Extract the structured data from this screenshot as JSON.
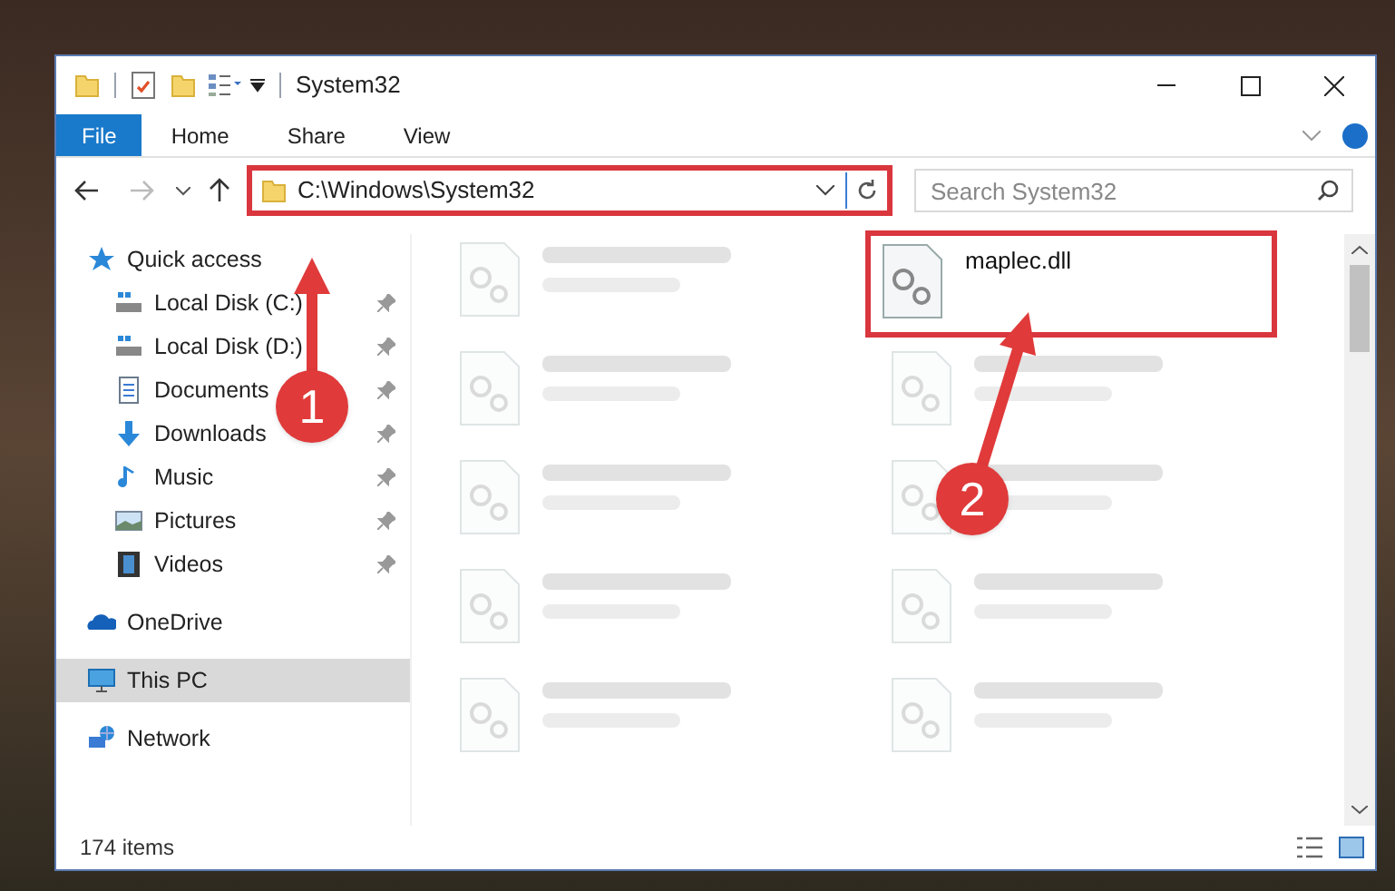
{
  "window": {
    "title": "System32"
  },
  "ribbon_tabs": [
    {
      "label": "File",
      "kind": "menu"
    },
    {
      "label": "Home",
      "kind": "tab"
    },
    {
      "label": "Share",
      "kind": "tab"
    },
    {
      "label": "View",
      "kind": "tab"
    }
  ],
  "address_bar": {
    "path": "C:\\Windows\\System32",
    "highlighted": true
  },
  "search": {
    "placeholder": "Search System32"
  },
  "sidebar": {
    "items": [
      {
        "label": "Quick access",
        "kind": "star",
        "pinned": false,
        "selected": false,
        "children": [
          {
            "label": "Local Disk (C:)",
            "kind": "drive",
            "pinned": true,
            "selected": false
          },
          {
            "label": "Local Disk (D:)",
            "kind": "drive",
            "pinned": true,
            "selected": false
          },
          {
            "label": "Documents",
            "kind": "documents",
            "pinned": true,
            "selected": false
          },
          {
            "label": "Downloads",
            "kind": "downloads",
            "pinned": true,
            "selected": false
          },
          {
            "label": "Music",
            "kind": "music",
            "pinned": true,
            "selected": false
          },
          {
            "label": "Pictures",
            "kind": "pictures",
            "pinned": true,
            "selected": false
          },
          {
            "label": "Videos",
            "kind": "videos",
            "pinned": true,
            "selected": false
          }
        ]
      },
      {
        "label": "OneDrive",
        "kind": "cloud",
        "pinned": false,
        "selected": false
      },
      {
        "label": "This PC",
        "kind": "pc",
        "pinned": false,
        "selected": true
      },
      {
        "label": "Network",
        "kind": "network",
        "pinned": false,
        "selected": false
      }
    ]
  },
  "files": [
    {
      "blurred": true,
      "highlighted": false
    },
    {
      "name": "maplec.dll",
      "blurred": false,
      "highlighted": true
    },
    {
      "blurred": true,
      "highlighted": false
    },
    {
      "blurred": true,
      "highlighted": false
    },
    {
      "blurred": true,
      "highlighted": false
    },
    {
      "blurred": true,
      "highlighted": false
    },
    {
      "blurred": true,
      "highlighted": false
    },
    {
      "blurred": true,
      "highlighted": false
    },
    {
      "blurred": true,
      "highlighted": false
    },
    {
      "blurred": true,
      "highlighted": false
    }
  ],
  "status_bar": {
    "item_count": "174 items"
  },
  "annotations": [
    {
      "label": "1"
    },
    {
      "label": "2"
    }
  ]
}
